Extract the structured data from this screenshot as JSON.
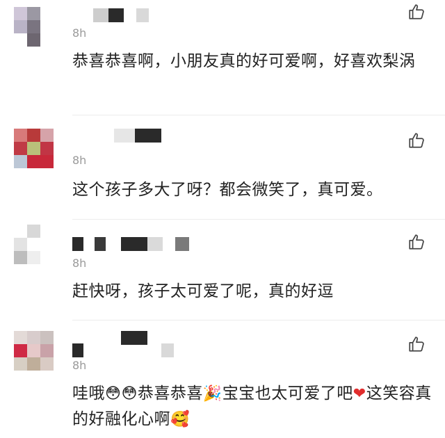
{
  "comments": [
    {
      "time": "8h",
      "text": "恭喜恭喜啊，小朋友真的好可爱啊，好喜欢梨涡",
      "avatar_colors": [
        "#cfc6d8",
        "#9b98a3",
        "#ffffff",
        "#b9b3c6",
        "#7a7480",
        "#ffffff",
        "#ffffff",
        "#6d6670",
        "#ffffff"
      ],
      "name_colors": [
        "#cdcdcd",
        "#2a2a2a",
        "#d9d9d9"
      ]
    },
    {
      "time": "8h",
      "text": "这个孩子多大了呀？都会微笑了，真可爱。",
      "avatar_colors": [
        "#d87a7a",
        "#b83a3a",
        "#d6a3a9",
        "#c03a45",
        "#b9c07a",
        "#c13545",
        "#bcc7d6",
        "#c8283a",
        "#c8283a"
      ],
      "name_colors": [
        "#e6e6e6",
        "#2a2a2a"
      ]
    },
    {
      "time": "8h",
      "text": "赶快呀，孩子太可爱了呢，真的好逗",
      "avatar_colors": [
        "#ffffff",
        "#d8d8d8",
        "#ffffff",
        "#e3e3e3",
        "#ffffff",
        "#ffffff",
        "#bdbdbd",
        "#eeeeee",
        "#ffffff"
      ],
      "name_colors": [
        "#2a2a2a",
        "#3a3a3a",
        "#2a2a2a",
        "#dadada",
        "#7a7a7a"
      ]
    },
    {
      "time": "8h",
      "text_parts": {
        "a": "哇哦",
        "emoji1": "😳",
        "emoji2": "😳",
        "b": "恭喜恭喜",
        "emoji3": "🎉",
        "c": "宝宝也太可爱了吧",
        "emoji4": "❤",
        "d": "这笑容真的好融化心啊",
        "emoji5": "🥰"
      },
      "avatar_colors": [
        "#e3dad7",
        "#d8cccc",
        "#cbc1bf",
        "#cf2a45",
        "#e6c9c9",
        "#c9a2a8",
        "#d7cfc4",
        "#bfae9a",
        "#d9cbc4"
      ],
      "name_colors": [
        "#2a2a2a",
        "#2a2a2a",
        "#d9d9d9"
      ]
    }
  ]
}
